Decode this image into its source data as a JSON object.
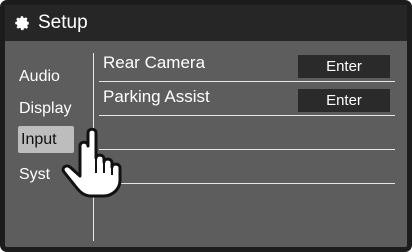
{
  "header": {
    "title": "Setup",
    "icon": "gear-icon"
  },
  "sidebar": {
    "items": [
      {
        "label": "Audio",
        "active": false
      },
      {
        "label": "Display",
        "active": false
      },
      {
        "label": "Input",
        "active": true
      },
      {
        "label": "Syst",
        "active": false
      }
    ]
  },
  "main": {
    "rows": [
      {
        "label": "Rear Camera",
        "button_label": "Enter"
      },
      {
        "label": "Parking Assist",
        "button_label": "Enter"
      },
      {
        "label": "",
        "button_label": ""
      },
      {
        "label": "",
        "button_label": ""
      }
    ]
  },
  "overlay": {
    "pointer_icon": "hand-pointer-icon"
  },
  "colors": {
    "panel_bg": "#5d5d5d",
    "header_bg": "#262626",
    "button_bg": "#2a2a2a",
    "active_item_bg": "#bdbdbd"
  }
}
